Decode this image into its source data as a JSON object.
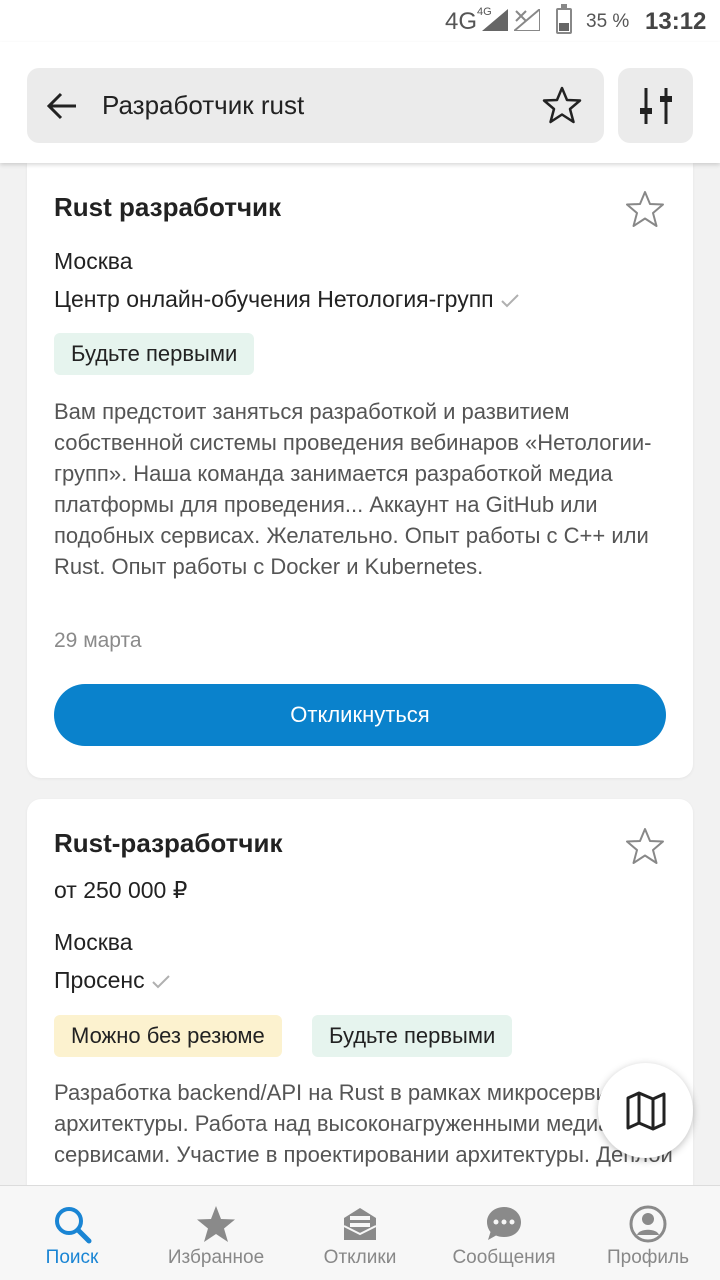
{
  "status_bar": {
    "network": "4G",
    "network_small": "4G",
    "battery": "35 %",
    "battery_level": 0.35,
    "time": "13:12"
  },
  "header": {
    "search_query": "Разработчик rust",
    "icons": [
      "back-arrow-icon",
      "star-outline-icon",
      "filter-sliders-icon"
    ]
  },
  "cards": [
    {
      "title": "Rust разработчик",
      "city": "Москва",
      "company": "Центр онлайн-обучения Нетология-групп",
      "tags": [
        "Будьте первыми"
      ],
      "description": "Вам предстоит заняться разработкой и развитием собственной системы проведения вебинаров «Нетологии-групп». Наша команда занимается разработкой медиа платформы для проведения... Аккаунт на GitHub или подобных сервисах. Желательно. Опыт работы с C++ или Rust. Опыт работы с Docker и Kubernetes.",
      "date": "29 марта",
      "button": "Откликнуться"
    },
    {
      "title": "Rust-разработчик",
      "salary": "от 250 000 ₽",
      "city": "Москва",
      "company": "Просенс",
      "tags": [
        "Можно без резюме",
        "Будьте первыми"
      ],
      "description": "Разработка backend/API на Rust в рамках микросервисной архитектуры. Работа над высоконагруженными медиа сервисами. Участие в проектировании архитектуры. Деплой"
    }
  ],
  "bottom_nav": [
    {
      "label": "Поиск",
      "icon": "search-icon",
      "active": true
    },
    {
      "label": "Избранное",
      "icon": "star-icon",
      "active": false
    },
    {
      "label": "Отклики",
      "icon": "inbox-icon",
      "active": false
    },
    {
      "label": "Сообщения",
      "icon": "chat-icon",
      "active": false
    },
    {
      "label": "Профиль",
      "icon": "profile-icon",
      "active": false
    }
  ],
  "colors": {
    "accent": "#0a82cc",
    "nav_active": "#1a85d4",
    "tag_green": "#e6f4ee",
    "tag_yellow": "#fcf2cf"
  }
}
